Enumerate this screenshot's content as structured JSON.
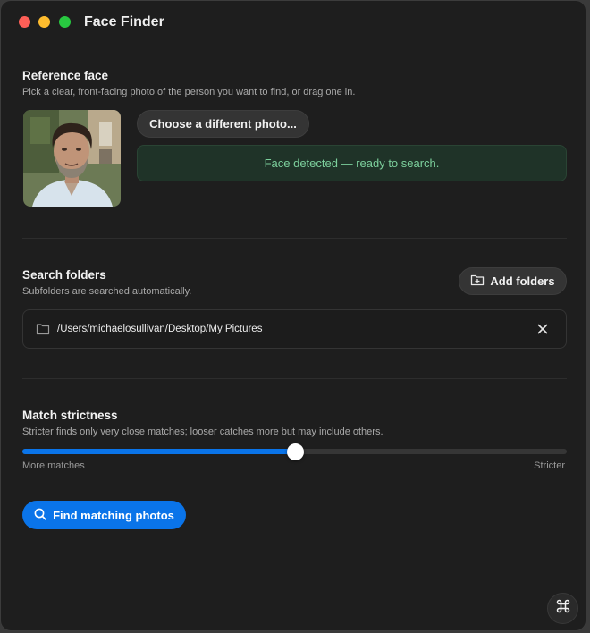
{
  "window": {
    "title": "Face Finder"
  },
  "reference": {
    "title": "Reference face",
    "subtitle": "Pick a clear, front-facing photo of the person you want to find, or drag one in.",
    "choose_label": "Choose a different photo...",
    "status": "Face detected — ready to search."
  },
  "folders": {
    "title": "Search folders",
    "subtitle": "Subfolders are searched automatically.",
    "add_label": "Add folders",
    "items": [
      {
        "path": "/Users/michaelosullivan/Desktop/My Pictures"
      }
    ]
  },
  "strictness": {
    "title": "Match strictness",
    "subtitle": "Stricter finds only very close matches; looser catches more but may include others.",
    "min_label": "More matches",
    "max_label": "Stricter",
    "value": 0.5
  },
  "actions": {
    "find_label": "Find matching photos"
  },
  "colors": {
    "accent": "#0a74e9",
    "success_text": "#7ccf9c",
    "success_bg": "#1f3328"
  }
}
